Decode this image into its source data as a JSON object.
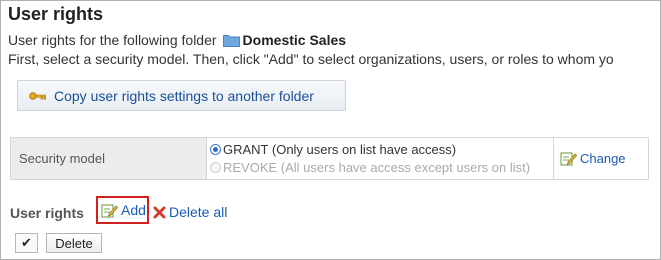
{
  "page": {
    "title": "User rights",
    "folder_intro": "User rights for the following folder",
    "folder_name": "Domestic Sales",
    "instruction": "First, select a security model. Then, click \"Add\" to select organizations, users, or roles to whom yo"
  },
  "copy_button": {
    "label": "Copy user rights settings to another folder",
    "icon": "key-icon"
  },
  "security_model": {
    "label": "Security model",
    "options": [
      {
        "label": "GRANT (Only users on list have access)",
        "selected": true
      },
      {
        "label": "REVOKE (All users have access except users on list)",
        "selected": false
      }
    ],
    "change_label": "Change"
  },
  "user_rights": {
    "heading": "User rights",
    "add_label": "Add",
    "delete_all_label": "Delete all"
  },
  "actions": {
    "check_symbol": "✔",
    "delete_label": "Delete"
  },
  "colors": {
    "link": "#1a5bb8",
    "highlight_border": "#d0201f",
    "folder": "#6fa8dc"
  }
}
